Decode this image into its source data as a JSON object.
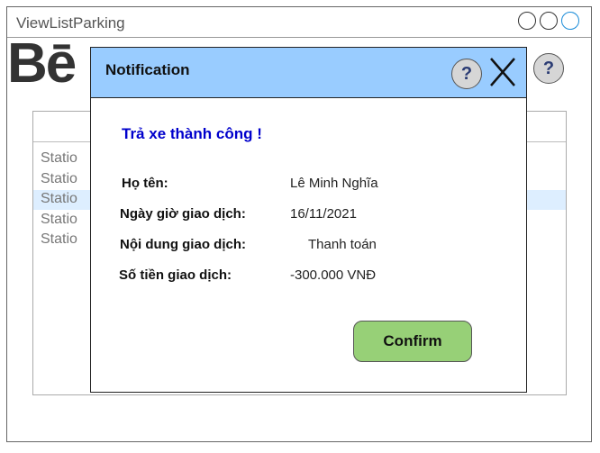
{
  "window": {
    "title": "ViewListParking"
  },
  "logo": {
    "text": "Bē"
  },
  "help": {
    "symbol": "?"
  },
  "list": {
    "items": [
      {
        "label": "Statio"
      },
      {
        "label": "Statio"
      },
      {
        "label": "Statio"
      },
      {
        "label": "Statio"
      },
      {
        "label": "Statio"
      }
    ],
    "selected_index": 2
  },
  "modal": {
    "title": "Notification",
    "help_symbol": "?",
    "success_message": "Trả xe thành công !",
    "fields": [
      {
        "label": "Họ tên:",
        "value": "Lê Minh Nghĩa"
      },
      {
        "label": "Ngày giờ giao dịch:",
        "value": "16/11/2021"
      },
      {
        "label": "Nội dung giao dịch:",
        "value": "Thanh toán"
      },
      {
        "label": "Số tiền giao dịch:",
        "value": "-300.000 VNĐ"
      }
    ],
    "confirm_label": "Confirm"
  },
  "colors": {
    "modal_header": "#99ccff",
    "confirm_button": "#97d077",
    "success_text": "#0000cc",
    "selected_row": "#ddeeff"
  }
}
